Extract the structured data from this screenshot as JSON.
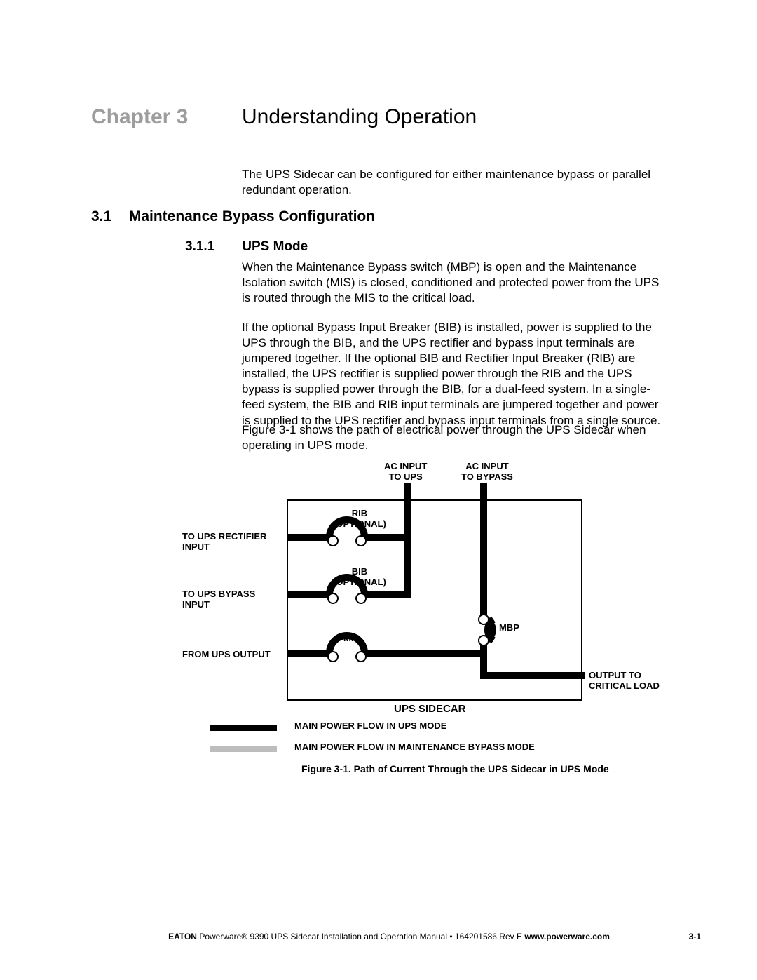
{
  "chapter": {
    "label": "Chapter 3",
    "title": "Understanding Operation"
  },
  "intro": "The UPS Sidecar can be configured for either maintenance bypass or parallel redundant operation.",
  "section1": {
    "num": "3.1",
    "title": "Maintenance Bypass Configuration"
  },
  "section2": {
    "num": "3.1.1",
    "title": "UPS Mode"
  },
  "para1": "When the Maintenance Bypass switch (MBP) is open and the Maintenance Isolation switch (MIS) is closed, conditioned and protected power from the UPS is routed through the MIS to the critical load.",
  "para2": "If the optional Bypass Input Breaker (BIB) is installed, power is supplied to the UPS through the BIB, and the UPS rectifier and bypass input terminals are jumpered together. If the optional BIB and Rectifier Input Breaker (RIB) are installed, the UPS rectifier is supplied power through the RIB and the UPS bypass is supplied power through the BIB, for a dual-feed system. In a single-feed system, the BIB and RIB input terminals are jumpered together and power is supplied to the UPS rectifier and bypass input terminals from a single source.",
  "para3": "Figure 3-1 shows the path of electrical power through the UPS Sidecar when operating in UPS mode.",
  "diagram": {
    "top_left_label": "AC INPUT\nTO UPS",
    "top_right_label": "AC INPUT\nTO BYPASS",
    "rib": "RIB\n(OPTIONAL)",
    "bib": "BIB\n(OPTIONAL)",
    "mis": "MIS",
    "mbp": "MBP",
    "left1": "TO UPS RECTIFIER\nINPUT",
    "left2": "TO UPS BYPASS\nINPUT",
    "left3": "FROM UPS OUTPUT",
    "right_out": "OUTPUT TO\nCRITICAL LOAD",
    "box_title": "UPS SIDECAR",
    "legend1": "MAIN POWER FLOW IN UPS MODE",
    "legend2": "MAIN POWER FLOW IN MAINTENANCE BYPASS MODE",
    "caption": "Figure 3-1. Path of Current Through the UPS Sidecar in UPS Mode"
  },
  "footer": {
    "brand": "EATON",
    "text": " Powerware® 9390 UPS Sidecar Installation and Operation Manual  •  164201586 Rev E ",
    "url": "www.powerware.com"
  },
  "page_number": "3-1"
}
